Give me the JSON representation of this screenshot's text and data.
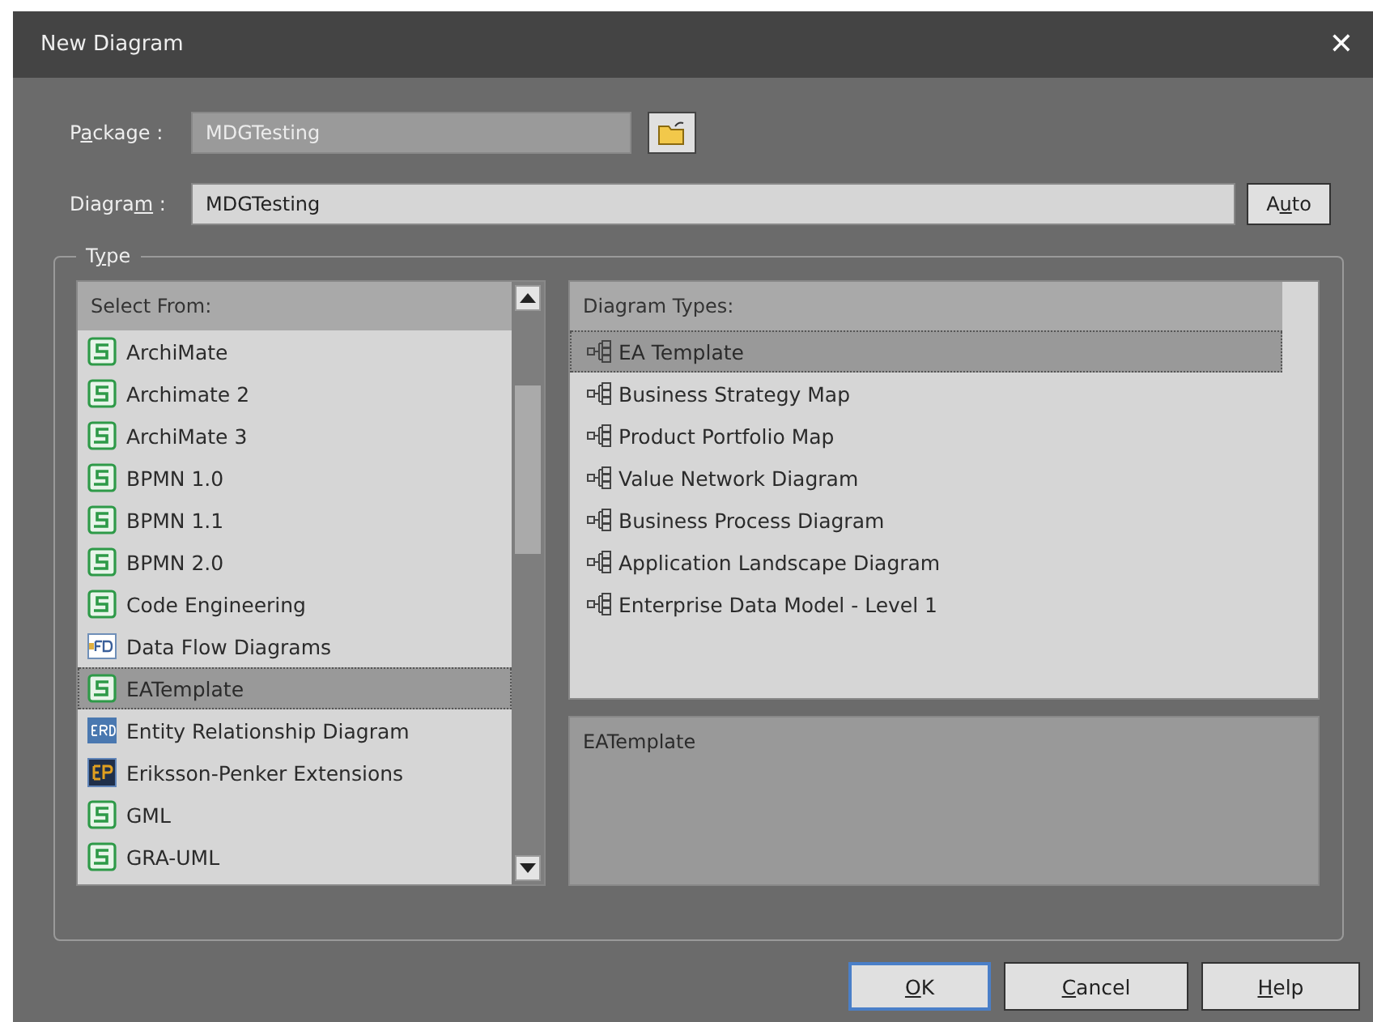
{
  "window": {
    "title": "New Diagram",
    "close": "✕"
  },
  "package": {
    "label": {
      "before": "P",
      "key": "a",
      "after": "ckage :"
    },
    "value": "MDGTesting",
    "disabled": true
  },
  "diagram": {
    "label": {
      "before": "Diagra",
      "key": "m",
      "after": " :"
    },
    "value": "MDGTesting"
  },
  "auto_button": {
    "before": "A",
    "key": "u",
    "after": "to"
  },
  "type_group": {
    "label": {
      "before": "T",
      "key": "y",
      "after": "pe"
    }
  },
  "select_from": {
    "header": "Select From:",
    "items": [
      {
        "label": "ArchiMate",
        "kind": "mdg",
        "selected": false
      },
      {
        "label": "Archimate 2",
        "kind": "mdg",
        "selected": false
      },
      {
        "label": "ArchiMate 3",
        "kind": "mdg",
        "selected": false
      },
      {
        "label": "BPMN 1.0",
        "kind": "mdg",
        "selected": false
      },
      {
        "label": "BPMN 1.1",
        "kind": "mdg",
        "selected": false
      },
      {
        "label": "BPMN 2.0",
        "kind": "mdg",
        "selected": false
      },
      {
        "label": "Code Engineering",
        "kind": "mdg",
        "selected": false
      },
      {
        "label": "Data Flow Diagrams",
        "kind": "dfd",
        "selected": false
      },
      {
        "label": "EATemplate",
        "kind": "mdg",
        "selected": true
      },
      {
        "label": "Entity Relationship Diagram",
        "kind": "erd",
        "selected": false
      },
      {
        "label": "Eriksson-Penker Extensions",
        "kind": "ep",
        "selected": false
      },
      {
        "label": "GML",
        "kind": "mdg",
        "selected": false
      },
      {
        "label": "GRA-UML",
        "kind": "mdg",
        "selected": false
      }
    ]
  },
  "diagram_types": {
    "header": "Diagram Types:",
    "items": [
      {
        "label": "EA Template",
        "selected": true
      },
      {
        "label": "Business Strategy Map",
        "selected": false
      },
      {
        "label": "Product Portfolio Map",
        "selected": false
      },
      {
        "label": "Value Network Diagram",
        "selected": false
      },
      {
        "label": "Business Process Diagram",
        "selected": false
      },
      {
        "label": "Application Landscape Diagram",
        "selected": false
      },
      {
        "label": "Enterprise Data Model - Level 1",
        "selected": false
      }
    ]
  },
  "description": "EATemplate",
  "buttons": [
    {
      "label": {
        "key": "O",
        "after": "K"
      },
      "default": true
    },
    {
      "label": {
        "key": "C",
        "after": "ancel"
      },
      "default": false
    },
    {
      "label": {
        "key": "H",
        "after": "elp"
      },
      "default": false
    }
  ]
}
